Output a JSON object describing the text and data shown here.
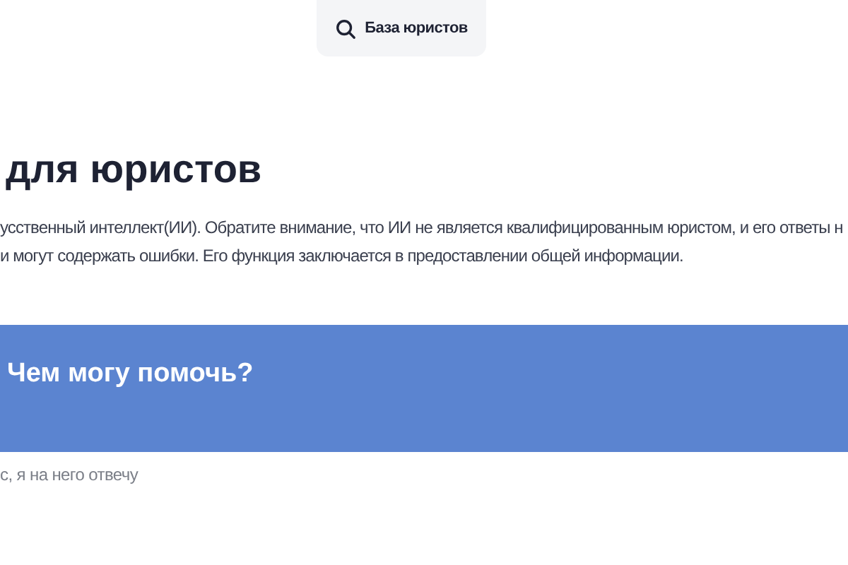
{
  "header": {
    "search_button": {
      "label": "База юристов"
    }
  },
  "title": "для юристов",
  "description": [
    "усственный интеллект(ИИ). Обратите внимание, что ИИ не является квалифицированным юристом, и его ответы н",
    "и могут содержать ошибки. Его функция заключается в предоставлении общей информации."
  ],
  "chat_panel": {
    "greeting": "Чем могу помочь?"
  },
  "hint": "с, я на него отвечу"
}
